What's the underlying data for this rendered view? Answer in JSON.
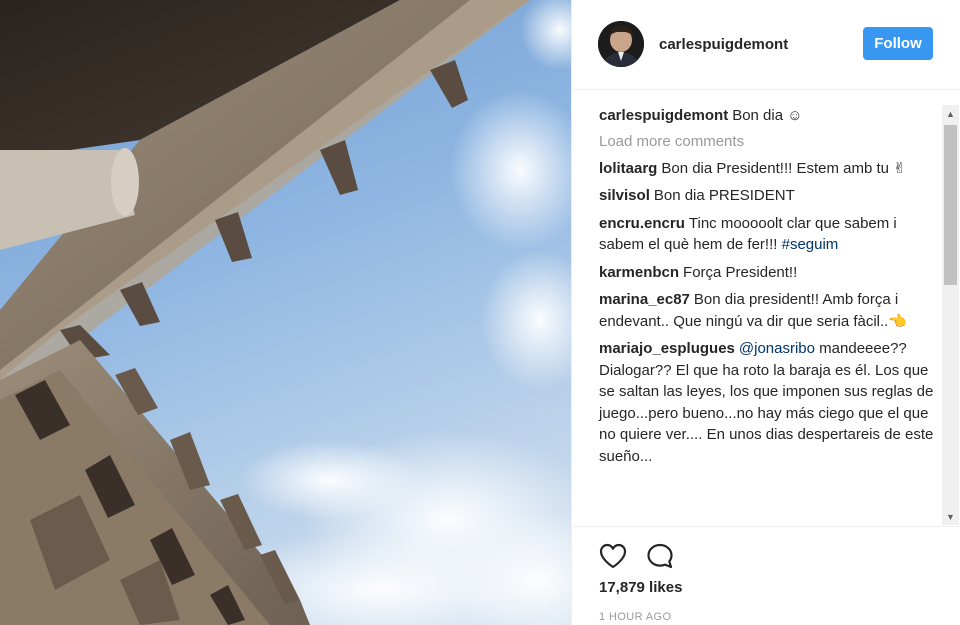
{
  "post": {
    "username": "carlespuigdemont",
    "follow_label": "Follow",
    "caption_user": "carlespuigdemont",
    "caption_text": "Bon dia ☺",
    "load_more": "Load more comments",
    "likes": "17,879 likes",
    "time_ago": "1 HOUR AGO"
  },
  "comments": [
    {
      "user": "lolitaarg",
      "text": "Bon dia President!!! Estem amb tu ✌"
    },
    {
      "user": "silvisol",
      "text": "Bon dia PRESIDENT"
    },
    {
      "user": "encru.encru",
      "text": "Tinc mooooolt clar que sabem i sabem el què hem de fer!!!",
      "tag": "#seguim"
    },
    {
      "user": "karmenbcn",
      "text": "Força President!!"
    },
    {
      "user": "marina_ec87",
      "text": "Bon dia president!! Amb força i endevant.. Que ningú va dir que seria fàcil..👈"
    },
    {
      "user": "mariajo_esplugues",
      "tag": "@jonasribo",
      "text": "mandeeee?? Dialogar?? El que ha roto la baraja es él. Los que se saltan las leyes, los que imponen sus reglas de juego...pero bueno...no hay más ciego que el que no quiere ver.... En unos dias despertareis de este sueño..."
    }
  ],
  "icons": {
    "like": "heart-outline-icon",
    "comment": "speech-bubble-icon",
    "scroll_up": "triangle-up",
    "scroll_down": "triangle-down"
  },
  "colors": {
    "follow_button": "#3897f0",
    "link": "#003569",
    "muted": "#999999",
    "text": "#262626"
  }
}
